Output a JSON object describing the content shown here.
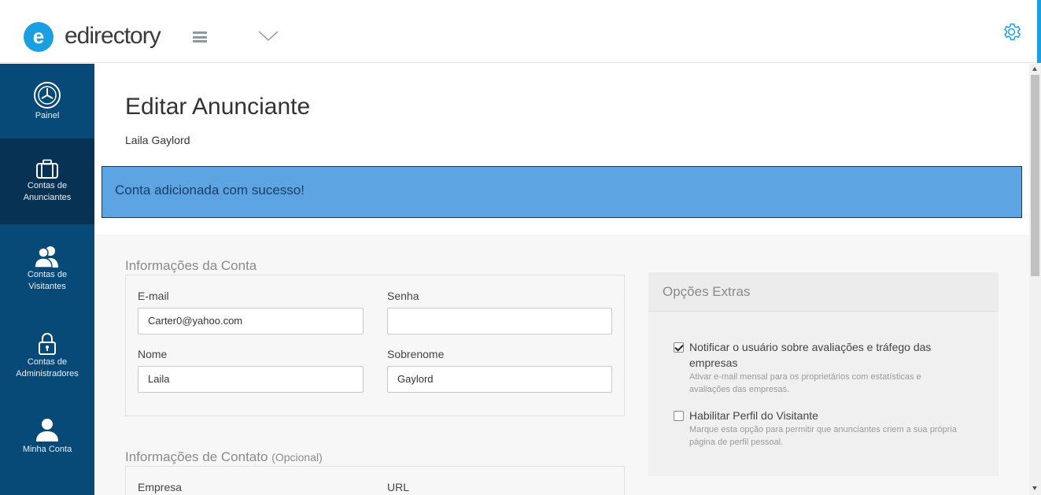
{
  "header": {
    "logo_letter": "e",
    "logo_text": "edirectory",
    "menu_icon": "hamburger-icon",
    "dropdown_icon": "chevron-down-icon",
    "settings_icon": "gear-icon"
  },
  "sidebar": {
    "items": [
      {
        "label": "Painel",
        "icon": "dashboard-icon",
        "active": false
      },
      {
        "label": "Contas de Anunciantes",
        "icon": "briefcase-icon",
        "active": true
      },
      {
        "label": "Contas de Visitantes",
        "icon": "users-icon",
        "active": false
      },
      {
        "label": "Contas de Administradores",
        "icon": "lock-icon",
        "active": false
      },
      {
        "label": "Minha Conta",
        "icon": "user-icon",
        "active": false
      }
    ]
  },
  "page": {
    "title": "Editar Anunciante",
    "subtitle": "Laila Gaylord"
  },
  "alert": {
    "message": "Conta adicionada com sucesso!"
  },
  "account_info": {
    "section_title": "Informações da Conta",
    "email_label": "E-mail",
    "email_value": "Carter0@yahoo.com",
    "password_label": "Senha",
    "password_value": "",
    "first_name_label": "Nome",
    "first_name_value": "Laila",
    "last_name_label": "Sobrenome",
    "last_name_value": "Gaylord"
  },
  "contact_info": {
    "section_title": "Informações de Contato",
    "section_optional": "(Opcional)",
    "company_label": "Empresa",
    "url_label": "URL"
  },
  "extras": {
    "title": "Opções Extras",
    "options": [
      {
        "label": "Notificar o usuário sobre avaliações e tráfego das empresas",
        "help": "Ativar e-mail mensal para os proprietários com estatísticas e avaliações das empresas.",
        "checked": true
      },
      {
        "label": "Habilitar Perfil do Visitante",
        "help": "Marque esta opção para permitir que anunciantes criem a sua própria página de perfil pessoal.",
        "checked": false
      }
    ]
  },
  "colors": {
    "brand": "#1aa0e0",
    "sidebar": "#074a78",
    "sidebar_active": "#073253",
    "alert_bg": "#5da5e2"
  }
}
